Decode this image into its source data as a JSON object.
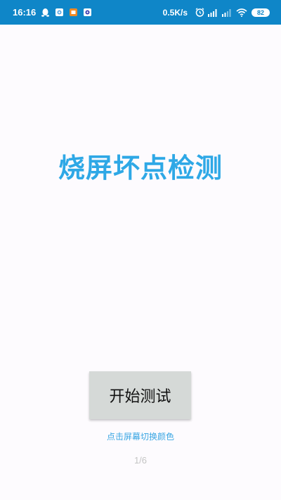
{
  "status_bar": {
    "time": "16:16",
    "network_speed": "0.5K/s",
    "battery_level": "82",
    "background_color": "#0f86c8",
    "notification_icons": [
      "qq-penguin-icon",
      "app-notification-icon",
      "app-notification-icon",
      "app-notification-icon"
    ],
    "right_icons": [
      "alarm-icon",
      "signal-icon",
      "signal-icon",
      "wifi-icon",
      "battery-icon"
    ]
  },
  "main": {
    "title": "烧屏坏点检测",
    "start_button_label": "开始测试",
    "hint": "点击屏幕切换颜色",
    "page_indicator": "1/6"
  },
  "colors": {
    "accent": "#2ea8e6",
    "button_bg": "#d5d9d7",
    "background": "#fdfbfe"
  }
}
